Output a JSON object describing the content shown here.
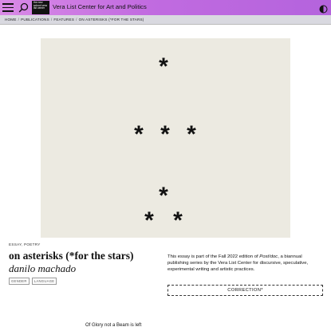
{
  "header": {
    "site_title": "Vera List Center for Art and Politics",
    "logo_text": "the new school vera list center",
    "icons": {
      "menu": "hamburger-menu-icon",
      "search": "search-icon",
      "theme": "contrast-toggle-icon"
    }
  },
  "breadcrumb": {
    "items": [
      "HOME",
      "PUBLICATIONS",
      "FEATURES",
      "ON ASTERISKS (*FOR THE STARS)"
    ],
    "separator": "/"
  },
  "hero": {
    "glyph": "*",
    "background": "#eceae1"
  },
  "article": {
    "kind": "ESSAY, POETRY",
    "title": "on asterisks (*for the stars)",
    "author": "danilo machado",
    "tags": [
      "GENDER",
      "LANGUAGE"
    ],
    "note_before": "This essay is part of the Fall 2022 edition of ",
    "note_pub": "Post/doc",
    "note_after": ", a biannual publishing series by the Vera List Center for discursive, speculative, experimental writing and artistic practices.",
    "correction_label": "CORRECTION*",
    "first_line": "Of Glory not a Beam is left"
  },
  "colors": {
    "header_gradient_start": "#d98ae6",
    "header_gradient_end": "#b463dd",
    "breadcrumb_bg": "#d9d9e0"
  }
}
